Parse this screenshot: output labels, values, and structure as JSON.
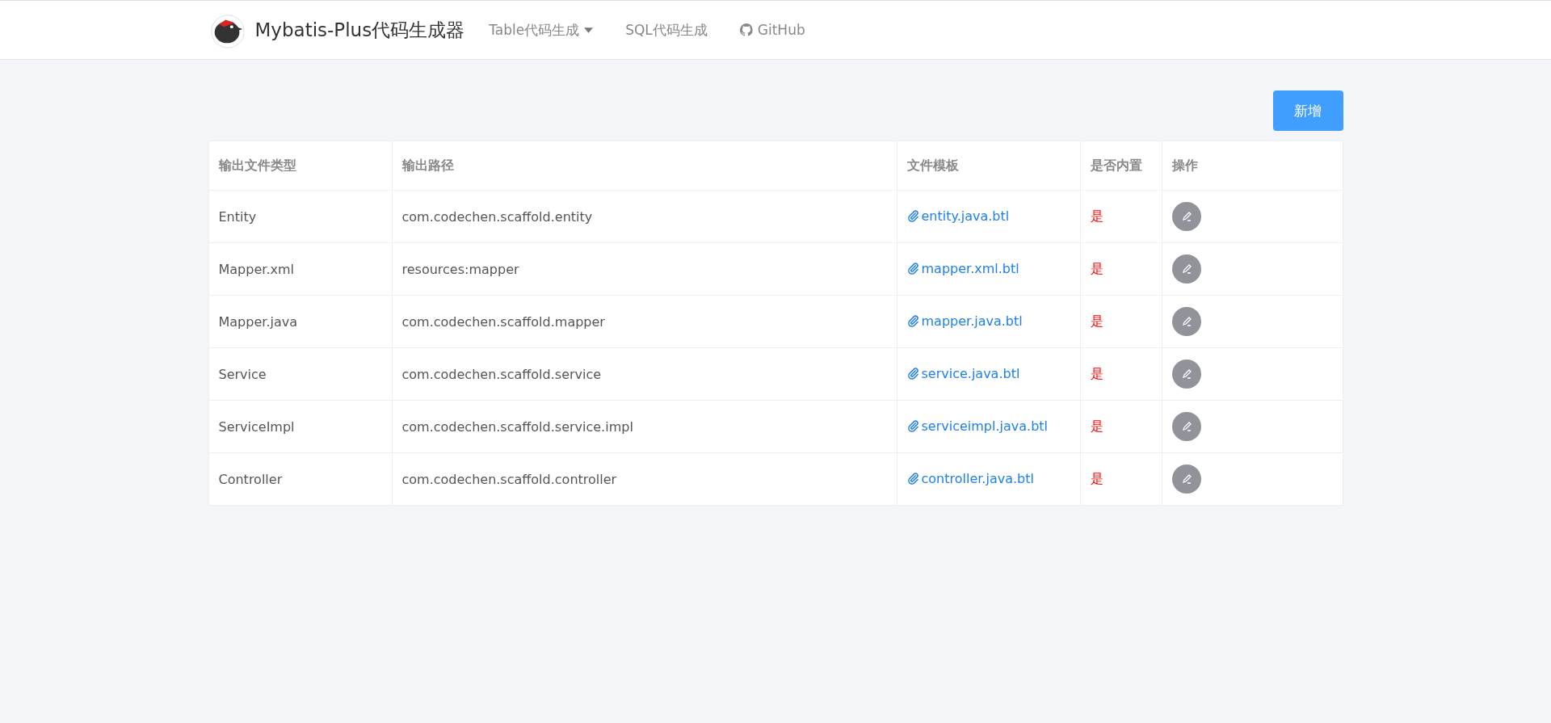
{
  "navbar": {
    "brand": "Mybatis-Plus代码生成器",
    "links": [
      {
        "label": "Table代码生成",
        "kind": "dropdown"
      },
      {
        "label": "SQL代码生成",
        "kind": "plain"
      },
      {
        "label": "GitHub",
        "kind": "github"
      }
    ]
  },
  "add_button": "新增",
  "table": {
    "columns": [
      "输出文件类型",
      "输出路径",
      "文件模板",
      "是否内置",
      "操作"
    ],
    "rows": [
      {
        "type": "Entity",
        "path": "com.codechen.scaffold.entity",
        "template": "entity.java.btl",
        "builtin": "是"
      },
      {
        "type": "Mapper.xml",
        "path": "resources:mapper",
        "template": "mapper.xml.btl",
        "builtin": "是"
      },
      {
        "type": "Mapper.java",
        "path": "com.codechen.scaffold.mapper",
        "template": "mapper.java.btl",
        "builtin": "是"
      },
      {
        "type": "Service",
        "path": "com.codechen.scaffold.service",
        "template": "service.java.btl",
        "builtin": "是"
      },
      {
        "type": "ServiceImpl",
        "path": "com.codechen.scaffold.service.impl",
        "template": "serviceimpl.java.btl",
        "builtin": "是"
      },
      {
        "type": "Controller",
        "path": "com.codechen.scaffold.controller",
        "template": "controller.java.btl",
        "builtin": "是"
      }
    ]
  }
}
